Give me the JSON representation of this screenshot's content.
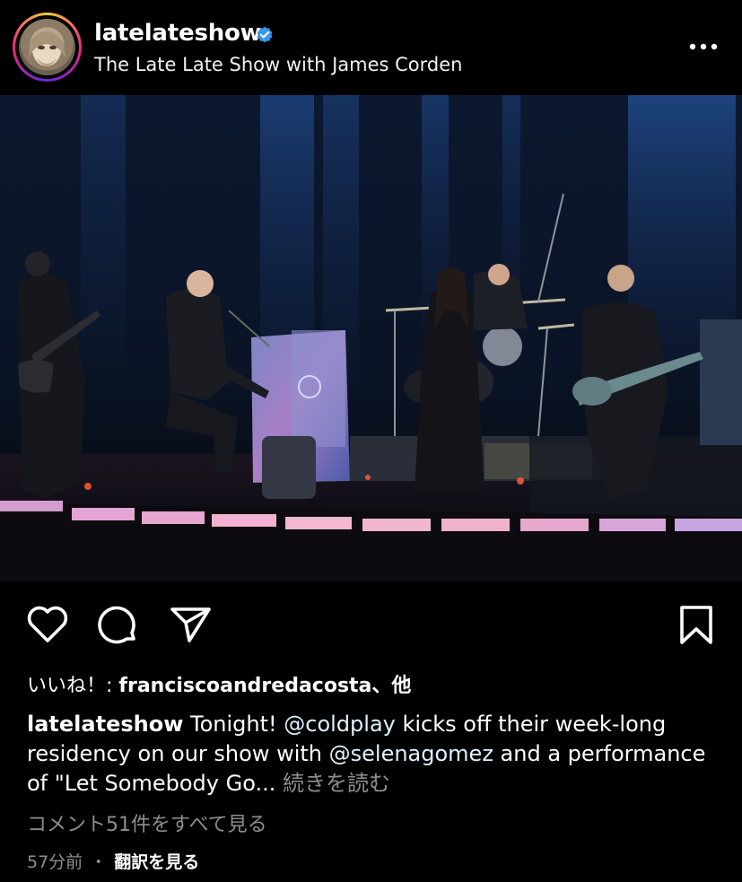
{
  "post": {
    "username": "latelateshow",
    "subtitle": "The Late Late Show with James Corden",
    "verified": true,
    "likes_prefix": "いいね！: ",
    "likes_name": "franciscoandredacosta",
    "likes_suffix": "、他",
    "caption": {
      "account": "latelateshow",
      "part1": " Tonight! ",
      "mention1": "@coldplay",
      "part2": " kicks off their week-long residency on our show with ",
      "mention2": "@selenagomez",
      "part3": " and a performance of \"Let Somebody Go... ",
      "more": "続きを読む"
    },
    "comments_link": "コメント51件をすべて見る",
    "time": "57分前",
    "separator": "・",
    "translate": "翻訳を見る"
  },
  "icons": {
    "like": "heart-icon",
    "comment": "comment-icon",
    "share": "paper-plane-icon",
    "save": "bookmark-icon",
    "more": "more-dots-icon",
    "verified": "verified-badge-icon"
  },
  "colors": {
    "background": "#000000",
    "verified": "#3897f0",
    "secondary_text": "#8e8e8e",
    "mention": "#e0f1ff"
  }
}
